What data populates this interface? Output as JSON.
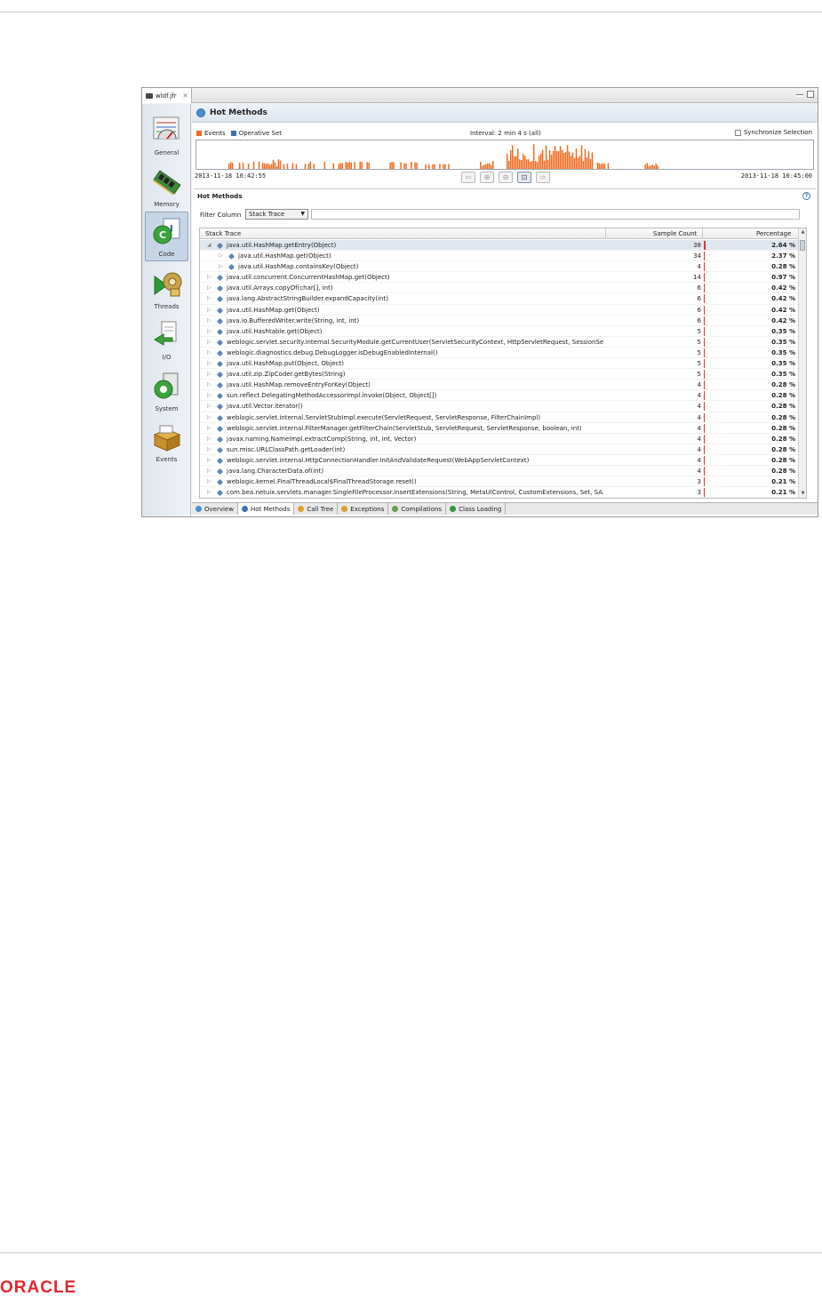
{
  "editor_tab": {
    "label": "wldf.jfr"
  },
  "sidebar": {
    "items": [
      {
        "label": "General",
        "icon": "general-gauge-icon"
      },
      {
        "label": "Memory",
        "icon": "memory-chip-icon"
      },
      {
        "label": "Code",
        "icon": "code-java-icon",
        "active": true
      },
      {
        "label": "Threads",
        "icon": "threads-gear-icon"
      },
      {
        "label": "I/O",
        "icon": "io-file-icon"
      },
      {
        "label": "System",
        "icon": "system-icon"
      },
      {
        "label": "Events",
        "icon": "events-box-icon"
      }
    ]
  },
  "header": {
    "title": "Hot Methods"
  },
  "timeline": {
    "legend_events": "Events",
    "legend_operative": "Operative Set",
    "interval": "Interval: 2 min 4 s (all)",
    "sync_label": "Synchronize Selection",
    "start": "2013-11-18 10:42:55",
    "end": "2013-11-18 10:45:00",
    "colors": {
      "events": "#f06a1f",
      "operative": "#3b72b3"
    }
  },
  "hot_methods": {
    "title": "Hot Methods",
    "filter_label": "Filter Column",
    "filter_value": "Stack Trace",
    "columns": {
      "trace": "Stack Trace",
      "count": "Sample Count",
      "percentage": "Percentage"
    },
    "rows": [
      {
        "indent": 0,
        "expanded": true,
        "method": "java.util.HashMap.getEntry(Object)",
        "count": "38",
        "pct": "2.64 %",
        "frac": 0.0264
      },
      {
        "indent": 1,
        "method": "java.util.HashMap.get(Object)",
        "count": "34",
        "pct": "2.37 %",
        "frac": 0.0237
      },
      {
        "indent": 1,
        "method": "java.util.HashMap.containsKey(Object)",
        "count": "4",
        "pct": "0.28 %",
        "frac": 0.0028
      },
      {
        "indent": 0,
        "method": "java.util.concurrent.ConcurrentHashMap.get(Object)",
        "count": "14",
        "pct": "0.97 %",
        "frac": 0.0097
      },
      {
        "indent": 0,
        "method": "java.util.Arrays.copyOf(char[], int)",
        "count": "6",
        "pct": "0.42 %",
        "frac": 0.0042
      },
      {
        "indent": 0,
        "method": "java.lang.AbstractStringBuilder.expandCapacity(int)",
        "count": "6",
        "pct": "0.42 %",
        "frac": 0.0042
      },
      {
        "indent": 0,
        "method": "java.util.HashMap.get(Object)",
        "count": "6",
        "pct": "0.42 %",
        "frac": 0.0042
      },
      {
        "indent": 0,
        "method": "java.io.BufferedWriter.write(String, int, int)",
        "count": "6",
        "pct": "0.42 %",
        "frac": 0.0042
      },
      {
        "indent": 0,
        "method": "java.util.Hashtable.get(Object)",
        "count": "5",
        "pct": "0.35 %",
        "frac": 0.0035
      },
      {
        "indent": 0,
        "method": "weblogic.servlet.security.internal.SecurityModule.getCurrentUser(ServletSecurityContext, HttpServletRequest, SessionSecu",
        "count": "5",
        "pct": "0.35 %",
        "frac": 0.0035
      },
      {
        "indent": 0,
        "method": "weblogic.diagnostics.debug.DebugLogger.isDebugEnabledInternal()",
        "count": "5",
        "pct": "0.35 %",
        "frac": 0.0035
      },
      {
        "indent": 0,
        "method": "java.util.HashMap.put(Object, Object)",
        "count": "5",
        "pct": "0.35 %",
        "frac": 0.0035
      },
      {
        "indent": 0,
        "method": "java.util.zip.ZipCoder.getBytes(String)",
        "count": "5",
        "pct": "0.35 %",
        "frac": 0.0035
      },
      {
        "indent": 0,
        "method": "java.util.HashMap.removeEntryForKey(Object)",
        "count": "4",
        "pct": "0.28 %",
        "frac": 0.0028
      },
      {
        "indent": 0,
        "method": "sun.reflect.DelegatingMethodAccessorImpl.invoke(Object, Object[])",
        "count": "4",
        "pct": "0.28 %",
        "frac": 0.0028
      },
      {
        "indent": 0,
        "method": "java.util.Vector.iterator()",
        "count": "4",
        "pct": "0.28 %",
        "frac": 0.0028
      },
      {
        "indent": 0,
        "method": "weblogic.servlet.internal.ServletStubImpl.execute(ServletRequest, ServletResponse, FilterChainImpl)",
        "count": "4",
        "pct": "0.28 %",
        "frac": 0.0028
      },
      {
        "indent": 0,
        "method": "weblogic.servlet.internal.FilterManager.getFilterChain(ServletStub, ServletRequest, ServletResponse, boolean, int)",
        "count": "4",
        "pct": "0.28 %",
        "frac": 0.0028
      },
      {
        "indent": 0,
        "method": "javax.naming.NameImpl.extractComp(String, int, int, Vector)",
        "count": "4",
        "pct": "0.28 %",
        "frac": 0.0028
      },
      {
        "indent": 0,
        "method": "sun.misc.URLClassPath.getLoader(int)",
        "count": "4",
        "pct": "0.28 %",
        "frac": 0.0028
      },
      {
        "indent": 0,
        "method": "weblogic.servlet.internal.HttpConnectionHandler.initAndValidateRequest(WebAppServletContext)",
        "count": "4",
        "pct": "0.28 %",
        "frac": 0.0028
      },
      {
        "indent": 0,
        "method": "java.lang.CharacterData.of(int)",
        "count": "4",
        "pct": "0.28 %",
        "frac": 0.0028
      },
      {
        "indent": 0,
        "method": "weblogic.kernel.FinalThreadLocal$FinalThreadStorage.reset()",
        "count": "3",
        "pct": "0.21 %",
        "frac": 0.0021
      },
      {
        "indent": 0,
        "method": "com.bea.netuix.servlets.manager.SingleFileProcessor.insertExtensions(String, MetaUIControl, CustomExtensions, Set, SAX",
        "count": "3",
        "pct": "0.21 %",
        "frac": 0.0021
      }
    ]
  },
  "bottom_tabs": [
    {
      "label": "Overview",
      "icon": "overview-icon"
    },
    {
      "label": "Hot Methods",
      "icon": "hot-methods-icon",
      "active": true
    },
    {
      "label": "Call Tree",
      "icon": "call-tree-icon"
    },
    {
      "label": "Exceptions",
      "icon": "exceptions-icon"
    },
    {
      "label": "Compilations",
      "icon": "compilations-icon"
    },
    {
      "label": "Class Loading",
      "icon": "class-loading-icon"
    }
  ],
  "footer": {
    "logo_text": "ORACLE"
  }
}
